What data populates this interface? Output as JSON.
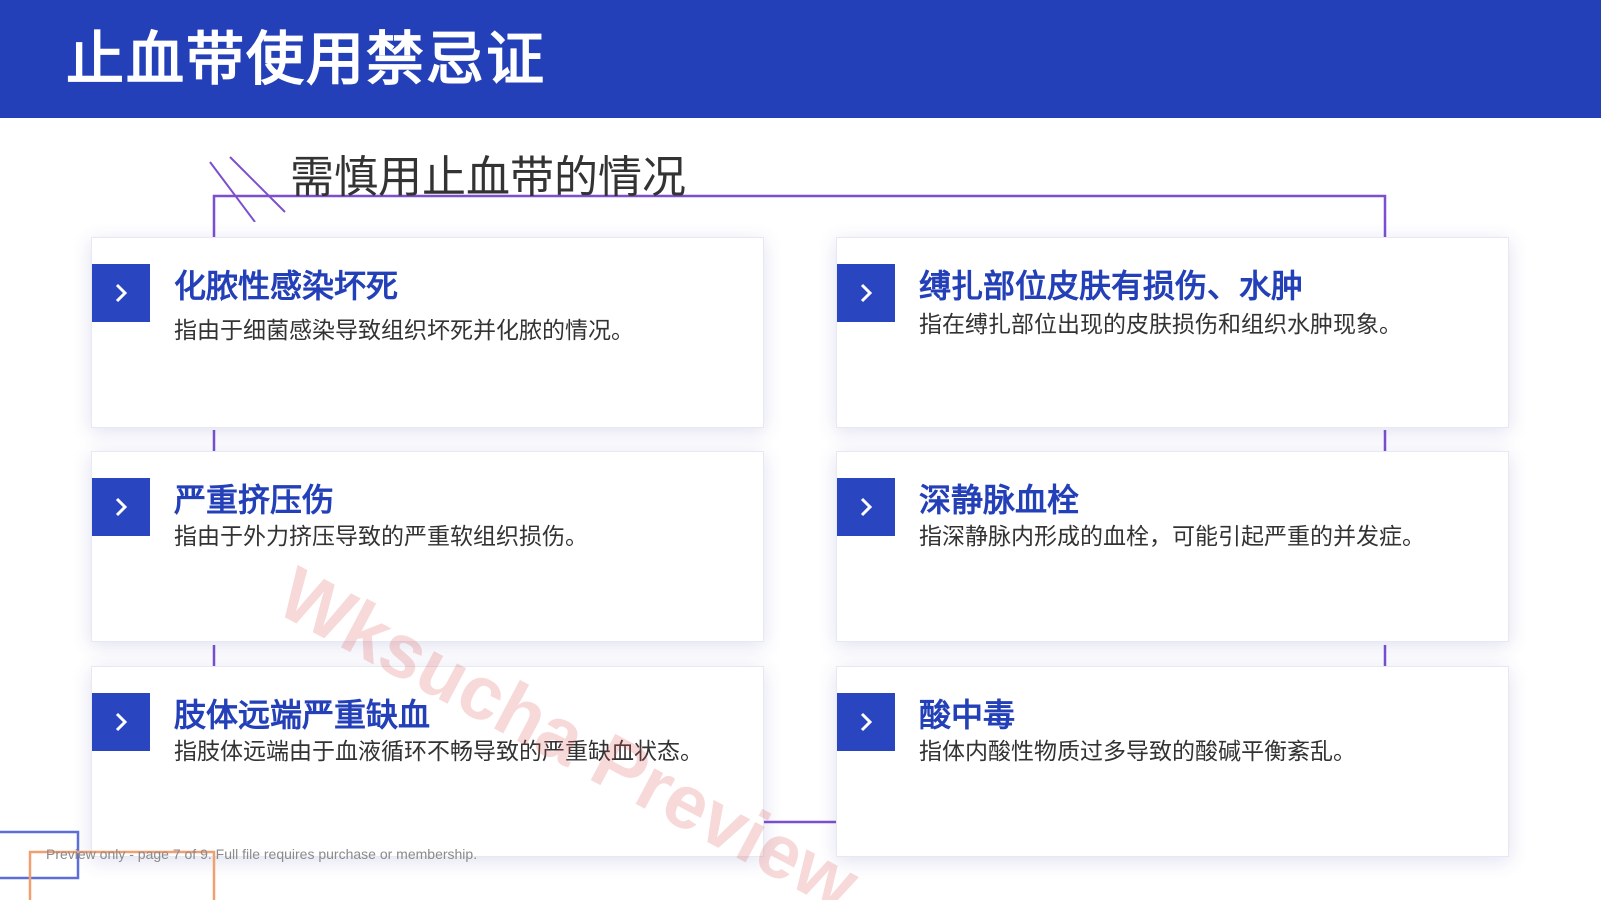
{
  "header": {
    "title": "止血带使用禁忌证"
  },
  "section": {
    "subtitle": "需慎用止血带的情况"
  },
  "cards": [
    {
      "title": "化脓性感染坏死",
      "desc": "指由于细菌感染导致组织坏死并化脓的情况。",
      "icon": "chevron-right-icon"
    },
    {
      "title": "缚扎部位皮肤有损伤、水肿",
      "desc": "指在缚扎部位出现的皮肤损伤和组织水肿现象。",
      "icon": "chevron-right-icon"
    },
    {
      "title": "严重挤压伤",
      "desc": "指由于外力挤压导致的严重软组织损伤。",
      "icon": "chevron-right-icon"
    },
    {
      "title": "深静脉血栓",
      "desc": "指深静脉内形成的血栓，可能引起严重的并发症。",
      "icon": "chevron-right-icon"
    },
    {
      "title": "肢体远端严重缺血",
      "desc": "指肢体远端由于血液循环不畅导致的严重缺血状态。",
      "icon": "chevron-right-icon"
    },
    {
      "title": "酸中毒",
      "desc": "指体内酸性物质过多导致的酸碱平衡紊乱。",
      "icon": "chevron-right-icon"
    }
  ],
  "watermark": {
    "text": "Wksucha Preview"
  },
  "footer": {
    "preview_note": "Preview only - page 7 of 9. Full file requires purchase or membership."
  },
  "colors": {
    "header_bg": "#2440b8",
    "accent": "#2a45c0",
    "frame_line": "#7b4fd0",
    "watermark": "#dc5050"
  }
}
